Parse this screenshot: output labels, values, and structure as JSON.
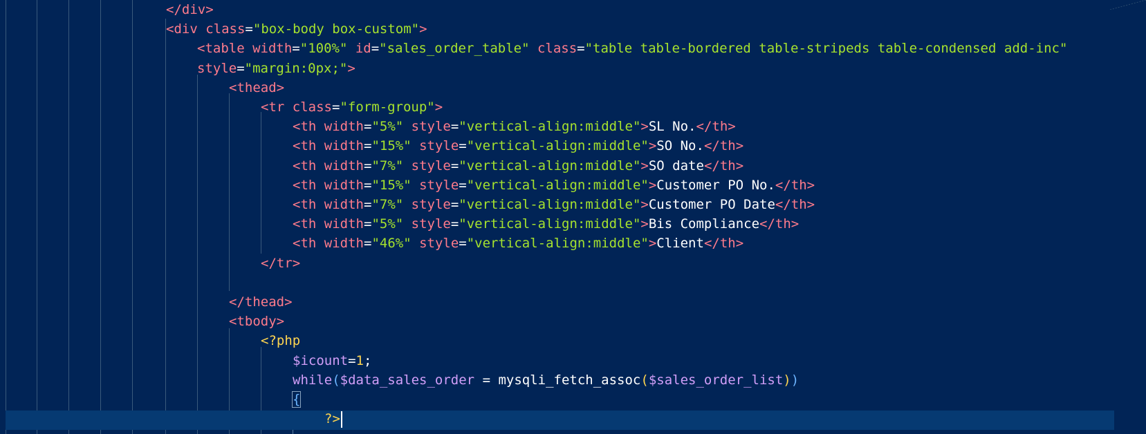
{
  "lines": [
    {
      "indent": 240,
      "tokens": [
        {
          "t": "</",
          "c": "punc"
        },
        {
          "t": "div",
          "c": "tag"
        },
        {
          "t": ">",
          "c": "punc"
        }
      ]
    },
    {
      "indent": 240,
      "tokens": [
        {
          "t": "<",
          "c": "punc"
        },
        {
          "t": "div",
          "c": "tag"
        },
        {
          "t": " class",
          "c": "attr"
        },
        {
          "t": "=",
          "c": "eq"
        },
        {
          "t": "\"box-body box-custom\"",
          "c": "str"
        },
        {
          "t": ">",
          "c": "punc"
        }
      ]
    },
    {
      "indent": 285,
      "tokens": [
        {
          "t": "<",
          "c": "punc"
        },
        {
          "t": "table",
          "c": "tag"
        },
        {
          "t": " width",
          "c": "attr"
        },
        {
          "t": "=",
          "c": "eq"
        },
        {
          "t": "\"100%\"",
          "c": "str"
        },
        {
          "t": " id",
          "c": "attr"
        },
        {
          "t": "=",
          "c": "eq"
        },
        {
          "t": "\"sales_order_table\"",
          "c": "str"
        },
        {
          "t": " class",
          "c": "attr"
        },
        {
          "t": "=",
          "c": "eq"
        },
        {
          "t": "\"table table-bordered table-stripeds table-condensed add-inc\"",
          "c": "str"
        }
      ]
    },
    {
      "indent": 285,
      "tokens": [
        {
          "t": "style",
          "c": "attr"
        },
        {
          "t": "=",
          "c": "eq"
        },
        {
          "t": "\"margin:0px;\"",
          "c": "str"
        },
        {
          "t": ">",
          "c": "punc"
        }
      ]
    },
    {
      "indent": 331,
      "tokens": [
        {
          "t": "<",
          "c": "punc"
        },
        {
          "t": "thead",
          "c": "tag"
        },
        {
          "t": ">",
          "c": "punc"
        }
      ]
    },
    {
      "indent": 377,
      "tokens": [
        {
          "t": "<",
          "c": "punc"
        },
        {
          "t": "tr",
          "c": "tag"
        },
        {
          "t": " class",
          "c": "attr"
        },
        {
          "t": "=",
          "c": "eq"
        },
        {
          "t": "\"form-group\"",
          "c": "str"
        },
        {
          "t": ">",
          "c": "punc"
        }
      ]
    },
    {
      "indent": 423,
      "tokens": [
        {
          "t": "<",
          "c": "punc"
        },
        {
          "t": "th",
          "c": "tag"
        },
        {
          "t": " width",
          "c": "attr"
        },
        {
          "t": "=",
          "c": "eq"
        },
        {
          "t": "\"5%\"",
          "c": "str"
        },
        {
          "t": " style",
          "c": "attr"
        },
        {
          "t": "=",
          "c": "eq"
        },
        {
          "t": "\"vertical-align:middle\"",
          "c": "str"
        },
        {
          "t": ">",
          "c": "punc"
        },
        {
          "t": "SL No.",
          "c": "txt"
        },
        {
          "t": "</",
          "c": "punc"
        },
        {
          "t": "th",
          "c": "tag"
        },
        {
          "t": ">",
          "c": "punc"
        }
      ]
    },
    {
      "indent": 423,
      "tokens": [
        {
          "t": "<",
          "c": "punc"
        },
        {
          "t": "th",
          "c": "tag"
        },
        {
          "t": " width",
          "c": "attr"
        },
        {
          "t": "=",
          "c": "eq"
        },
        {
          "t": "\"15%\"",
          "c": "str"
        },
        {
          "t": " style",
          "c": "attr"
        },
        {
          "t": "=",
          "c": "eq"
        },
        {
          "t": "\"vertical-align:middle\"",
          "c": "str"
        },
        {
          "t": ">",
          "c": "punc"
        },
        {
          "t": "SO No.",
          "c": "txt"
        },
        {
          "t": "</",
          "c": "punc"
        },
        {
          "t": "th",
          "c": "tag"
        },
        {
          "t": ">",
          "c": "punc"
        }
      ]
    },
    {
      "indent": 423,
      "tokens": [
        {
          "t": "<",
          "c": "punc"
        },
        {
          "t": "th",
          "c": "tag"
        },
        {
          "t": " width",
          "c": "attr"
        },
        {
          "t": "=",
          "c": "eq"
        },
        {
          "t": "\"7%\"",
          "c": "str"
        },
        {
          "t": " style",
          "c": "attr"
        },
        {
          "t": "=",
          "c": "eq"
        },
        {
          "t": "\"vertical-align:middle\"",
          "c": "str"
        },
        {
          "t": ">",
          "c": "punc"
        },
        {
          "t": "SO date",
          "c": "txt"
        },
        {
          "t": "</",
          "c": "punc"
        },
        {
          "t": "th",
          "c": "tag"
        },
        {
          "t": ">",
          "c": "punc"
        }
      ]
    },
    {
      "indent": 423,
      "tokens": [
        {
          "t": "<",
          "c": "punc"
        },
        {
          "t": "th",
          "c": "tag"
        },
        {
          "t": " width",
          "c": "attr"
        },
        {
          "t": "=",
          "c": "eq"
        },
        {
          "t": "\"15%\"",
          "c": "str"
        },
        {
          "t": " style",
          "c": "attr"
        },
        {
          "t": "=",
          "c": "eq"
        },
        {
          "t": "\"vertical-align:middle\"",
          "c": "str"
        },
        {
          "t": ">",
          "c": "punc"
        },
        {
          "t": "Customer PO No.",
          "c": "txt"
        },
        {
          "t": "</",
          "c": "punc"
        },
        {
          "t": "th",
          "c": "tag"
        },
        {
          "t": ">",
          "c": "punc"
        }
      ]
    },
    {
      "indent": 423,
      "tokens": [
        {
          "t": "<",
          "c": "punc"
        },
        {
          "t": "th",
          "c": "tag"
        },
        {
          "t": " width",
          "c": "attr"
        },
        {
          "t": "=",
          "c": "eq"
        },
        {
          "t": "\"7%\"",
          "c": "str"
        },
        {
          "t": " style",
          "c": "attr"
        },
        {
          "t": "=",
          "c": "eq"
        },
        {
          "t": "\"vertical-align:middle\"",
          "c": "str"
        },
        {
          "t": ">",
          "c": "punc"
        },
        {
          "t": "Customer PO Date",
          "c": "txt"
        },
        {
          "t": "</",
          "c": "punc"
        },
        {
          "t": "th",
          "c": "tag"
        },
        {
          "t": ">",
          "c": "punc"
        }
      ]
    },
    {
      "indent": 423,
      "tokens": [
        {
          "t": "<",
          "c": "punc"
        },
        {
          "t": "th",
          "c": "tag"
        },
        {
          "t": " width",
          "c": "attr"
        },
        {
          "t": "=",
          "c": "eq"
        },
        {
          "t": "\"5%\"",
          "c": "str"
        },
        {
          "t": " style",
          "c": "attr"
        },
        {
          "t": "=",
          "c": "eq"
        },
        {
          "t": "\"vertical-align:middle\"",
          "c": "str"
        },
        {
          "t": ">",
          "c": "punc"
        },
        {
          "t": "Bis Compliance",
          "c": "txt"
        },
        {
          "t": "</",
          "c": "punc"
        },
        {
          "t": "th",
          "c": "tag"
        },
        {
          "t": ">",
          "c": "punc"
        }
      ]
    },
    {
      "indent": 423,
      "tokens": [
        {
          "t": "<",
          "c": "punc"
        },
        {
          "t": "th",
          "c": "tag"
        },
        {
          "t": " width",
          "c": "attr"
        },
        {
          "t": "=",
          "c": "eq"
        },
        {
          "t": "\"46%\"",
          "c": "str"
        },
        {
          "t": " style",
          "c": "attr"
        },
        {
          "t": "=",
          "c": "eq"
        },
        {
          "t": "\"vertical-align:middle\"",
          "c": "str"
        },
        {
          "t": ">",
          "c": "punc"
        },
        {
          "t": "Client",
          "c": "txt"
        },
        {
          "t": "</",
          "c": "punc"
        },
        {
          "t": "th",
          "c": "tag"
        },
        {
          "t": ">",
          "c": "punc"
        }
      ]
    },
    {
      "indent": 377,
      "tokens": [
        {
          "t": "</",
          "c": "punc"
        },
        {
          "t": "tr",
          "c": "tag"
        },
        {
          "t": ">",
          "c": "punc"
        }
      ]
    },
    {
      "indent": 331,
      "tokens": []
    },
    {
      "indent": 331,
      "tokens": [
        {
          "t": "</",
          "c": "punc"
        },
        {
          "t": "thead",
          "c": "tag"
        },
        {
          "t": ">",
          "c": "punc"
        }
      ]
    },
    {
      "indent": 331,
      "tokens": [
        {
          "t": "<",
          "c": "punc"
        },
        {
          "t": "tbody",
          "c": "tag"
        },
        {
          "t": ">",
          "c": "punc"
        }
      ]
    },
    {
      "indent": 377,
      "tokens": [
        {
          "t": "<?php",
          "c": "php"
        }
      ]
    },
    {
      "indent": 423,
      "tokens": [
        {
          "t": "$icount",
          "c": "var"
        },
        {
          "t": "=",
          "c": "op"
        },
        {
          "t": "1",
          "c": "num"
        },
        {
          "t": ";",
          "c": "semi"
        }
      ]
    },
    {
      "indent": 423,
      "tokens": [
        {
          "t": "while",
          "c": "kw"
        },
        {
          "t": "(",
          "c": "pa2"
        },
        {
          "t": "$data_sales_order",
          "c": "var"
        },
        {
          "t": " = ",
          "c": "op"
        },
        {
          "t": "mysqli_fetch_assoc",
          "c": "fn"
        },
        {
          "t": "(",
          "c": "pa1"
        },
        {
          "t": "$sales_order_list",
          "c": "var"
        },
        {
          "t": ")",
          "c": "pa1"
        },
        {
          "t": ")",
          "c": "pa2"
        }
      ]
    },
    {
      "indent": 423,
      "tokens": [
        {
          "t": "{",
          "c": "brace",
          "box": true
        }
      ]
    },
    {
      "indent": 469,
      "tokens": [
        {
          "t": "?>",
          "c": "php"
        }
      ],
      "caret": true
    }
  ]
}
